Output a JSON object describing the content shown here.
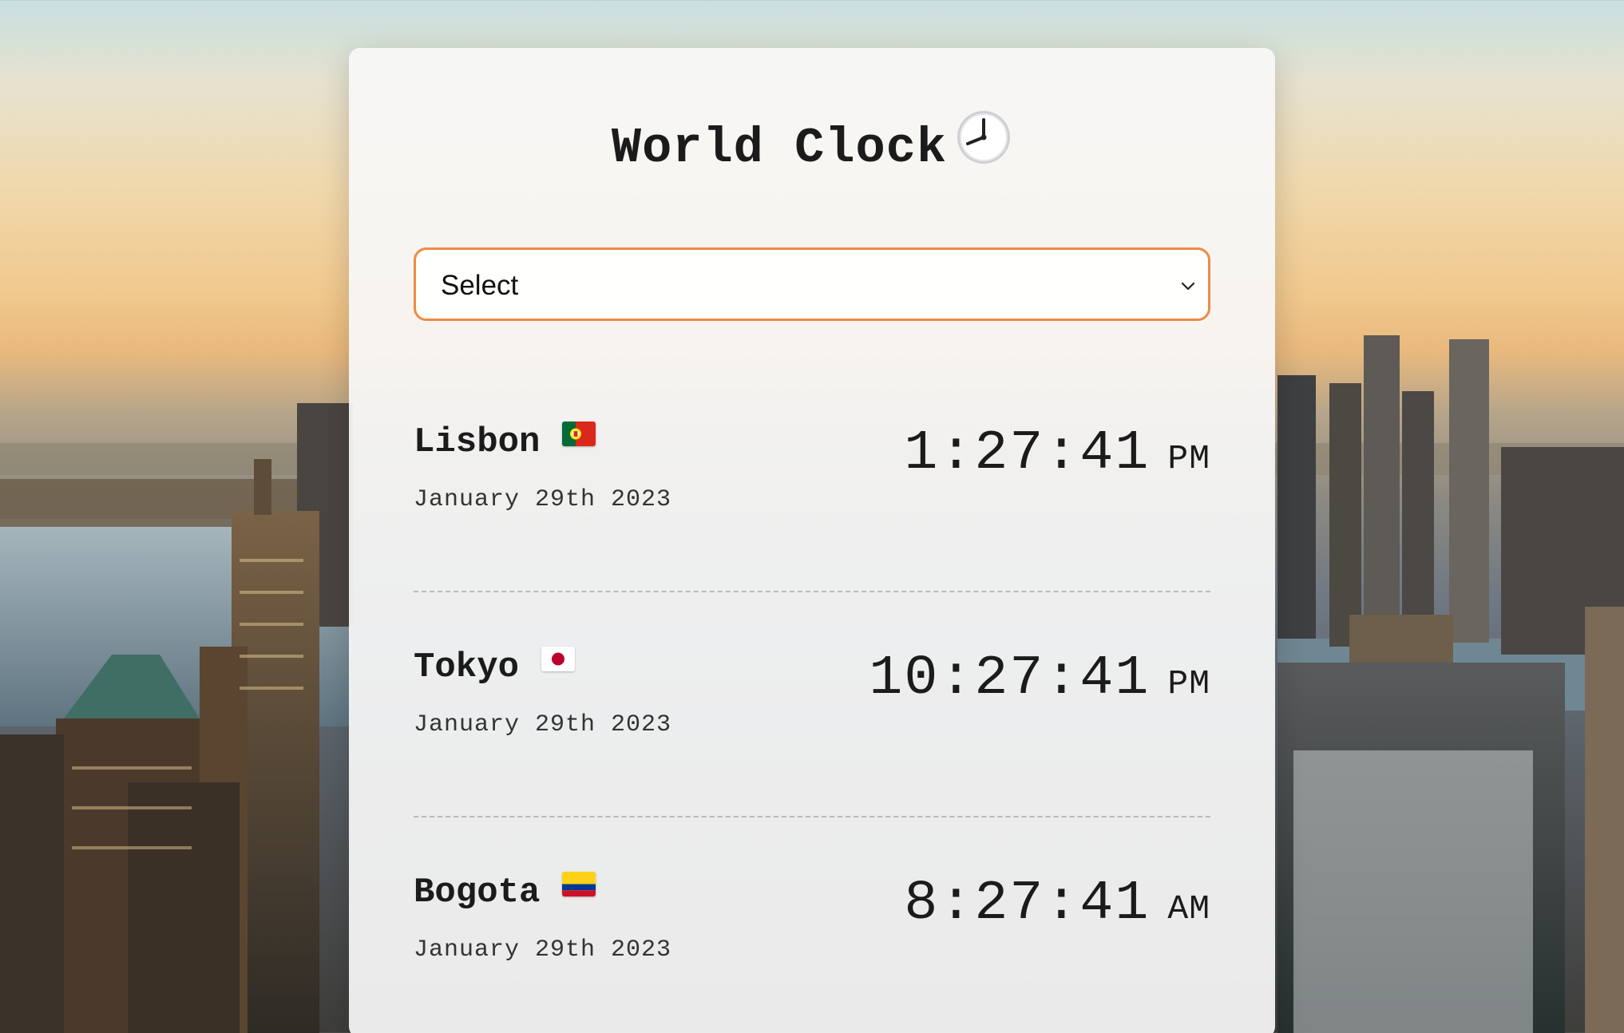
{
  "app": {
    "title": "World Clock",
    "title_icon": "clock-icon"
  },
  "city_select": {
    "value": "Select",
    "icon": "chevron-down-icon"
  },
  "cities": [
    {
      "name": "Lisbon",
      "flag": "portugal-flag-icon",
      "date": "January 29th 2023",
      "time": "1:27:41",
      "ampm": "PM"
    },
    {
      "name": "Tokyo",
      "flag": "japan-flag-icon",
      "date": "January 29th 2023",
      "time": "10:27:41",
      "ampm": "PM"
    },
    {
      "name": "Bogota",
      "flag": "colombia-flag-icon",
      "date": "January 29th 2023",
      "time": "8:27:41",
      "ampm": "AM"
    }
  ],
  "colors": {
    "select_border": "#ef8a43",
    "card_background": "#f7f7f7",
    "text": "#1b1b1b"
  }
}
